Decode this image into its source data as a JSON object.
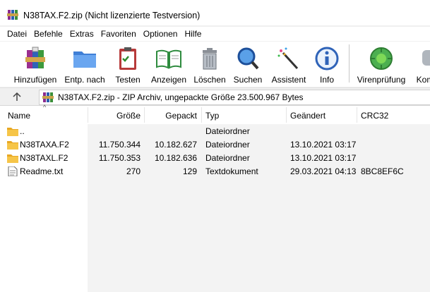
{
  "window": {
    "title": "N38TAX.F2.zip (Nicht lizenzierte Testversion)"
  },
  "menu": [
    "Datei",
    "Befehle",
    "Extras",
    "Favoriten",
    "Optionen",
    "Hilfe"
  ],
  "toolbar": {
    "add": "Hinzufügen",
    "extract": "Entp. nach",
    "test": "Testen",
    "view": "Anzeigen",
    "delete": "Löschen",
    "find": "Suchen",
    "wizard": "Assistent",
    "info": "Info",
    "virus": "Virenprüfung",
    "comment": "Kom"
  },
  "address": {
    "text": "N38TAX.F2.zip - ZIP Archiv, ungepackte Größe 23.500.967 Bytes"
  },
  "columns": {
    "name": "Name",
    "size": "Größe",
    "packed": "Gepackt",
    "type": "Typ",
    "modified": "Geändert",
    "crc": "CRC32"
  },
  "files": [
    {
      "name": "..",
      "size": "",
      "packed": "",
      "type": "Dateiordner",
      "modified": "",
      "crc": "",
      "icon": "folder-icon"
    },
    {
      "name": "N38TAXA.F2",
      "size": "11.750.344",
      "packed": "10.182.627",
      "type": "Dateiordner",
      "modified": "13.10.2021 03:17",
      "crc": "",
      "icon": "folder-icon"
    },
    {
      "name": "N38TAXL.F2",
      "size": "11.750.353",
      "packed": "10.182.636",
      "type": "Dateiordner",
      "modified": "13.10.2021 03:17",
      "crc": "",
      "icon": "folder-icon"
    },
    {
      "name": "Readme.txt",
      "size": "270",
      "packed": "129",
      "type": "Textdokument",
      "modified": "29.03.2021 04:13",
      "crc": "8BC8EF6C",
      "icon": "text-file-icon"
    }
  ]
}
